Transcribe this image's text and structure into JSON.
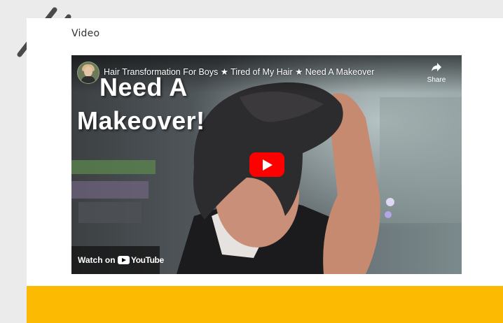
{
  "section": {
    "label": "Video"
  },
  "video": {
    "title": "Hair Transformation For Boys ★ Tired of My Hair ★ Need A Makeover",
    "overlay_lines": [
      "Need A",
      "Makeover!"
    ],
    "share_label": "Share",
    "watch_on_label": "Watch on",
    "youtube_wordmark": "YouTube",
    "play_button_color": "#ff0000"
  },
  "colors": {
    "accent_bar": "#fcba03",
    "page_background": "#ebebeb",
    "card_background": "#ffffff"
  },
  "icons": [
    "slash-decoration-icon",
    "channel-avatar-icon",
    "share-icon",
    "play-icon",
    "youtube-logo-icon"
  ]
}
